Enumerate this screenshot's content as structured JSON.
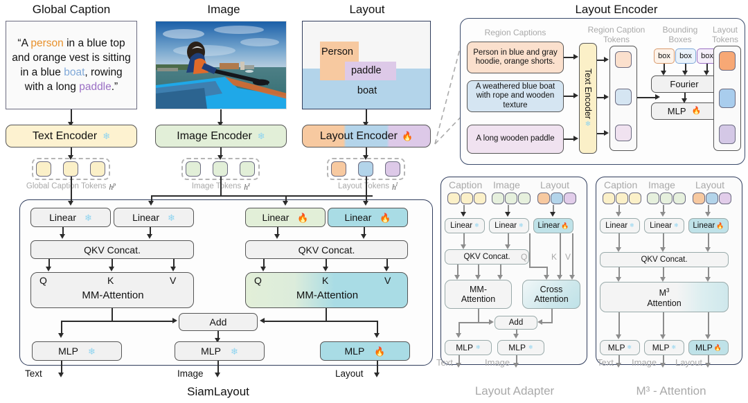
{
  "titles": {
    "global_caption": "Global Caption",
    "image": "Image",
    "layout": "Layout",
    "layout_encoder": "Layout Encoder",
    "siamlayout": "SiamLayout",
    "layout_adapter": "Layout Adapter",
    "m3_attention": "M³ - Attention"
  },
  "global_caption": {
    "open_quote": "“",
    "seg1": "A ",
    "person": "person",
    "seg2": " in a blue top and orange vest is sitting in a blue ",
    "boat": "boat",
    "seg3": ", rowing with a long ",
    "paddle": "paddle",
    "close": ".”",
    "full_text": "“A person in a blue top and orange vest is sitting in a blue boat, rowing with a long paddle.”"
  },
  "layout_canvas": {
    "person": "Person",
    "paddle": "paddle",
    "boat": "boat"
  },
  "encoders": {
    "text": "Text Encoder",
    "image": "Image Encoder",
    "layout": "Layout Encoder",
    "frozen_icon": "snowflake-icon",
    "trainable_icon": "fire-icon"
  },
  "token_labels": {
    "caption": "Global Caption Tokens",
    "caption_h": "h",
    "caption_sup": "p",
    "image": "Image Tokens",
    "image_h": "h",
    "image_sup": "z",
    "layout": "Layout Tokens",
    "layout_h": "h",
    "layout_sup": "l"
  },
  "siam": {
    "linear": "Linear",
    "qkv": "QKV Concat.",
    "q": "Q",
    "k": "K",
    "v": "V",
    "mm_attention": "MM-Attention",
    "add": "Add",
    "mlp": "MLP",
    "out_text": "Text",
    "out_image": "Image",
    "out_layout": "Layout"
  },
  "layout_encoder_detail": {
    "region_captions_label": "Region Captions",
    "region_caption_tokens_label": "Region Caption Tokens",
    "bounding_boxes_label": "Bounding Boxes",
    "layout_tokens_label": "Layout Tokens",
    "captions": [
      "Person in blue and gray hoodie, orange shorts.",
      "A weathered blue boat with rope and wooden texture",
      "A long wooden paddle"
    ],
    "text_encoder": "Text Encoder",
    "box": "box",
    "fourier": "Fourier",
    "mlp": "MLP"
  },
  "adapter": {
    "col_caption": "Caption",
    "col_image": "Image",
    "col_layout": "Layout",
    "linear": "Linear",
    "qkv": "QKV Concat.",
    "q": "Q",
    "k": "K",
    "v": "V",
    "mm_attention_l1": "MM-",
    "mm_attention_l2": "Attention",
    "cross_l1": "Cross",
    "cross_l2": "Attention",
    "add": "Add",
    "mlp": "MLP",
    "out_text": "Text",
    "out_image": "Image"
  },
  "m3": {
    "col_caption": "Caption",
    "col_image": "Image",
    "col_layout": "Layout",
    "linear": "Linear",
    "qkv": "QKV Concat.",
    "attn_l1": "M",
    "attn_sup": "3",
    "attn_l2": "Attention",
    "mlp": "MLP",
    "out_text": "Text",
    "out_image": "Image",
    "out_layout": "Layout"
  },
  "colors": {
    "person_orange": "#f7c9a0",
    "boat_blue": "#b3d4ea",
    "paddle_purple": "#ddc9e8",
    "caption_yellow": "#fbf0c8",
    "image_green": "#dde9d2",
    "cyan": "#a9dce5",
    "text_orange": "#e8912c",
    "text_blue": "#7fa8d8",
    "text_purple": "#9a6fc4",
    "gray_label": "#a9a9a9",
    "node_gray": "#f1f1f1"
  }
}
